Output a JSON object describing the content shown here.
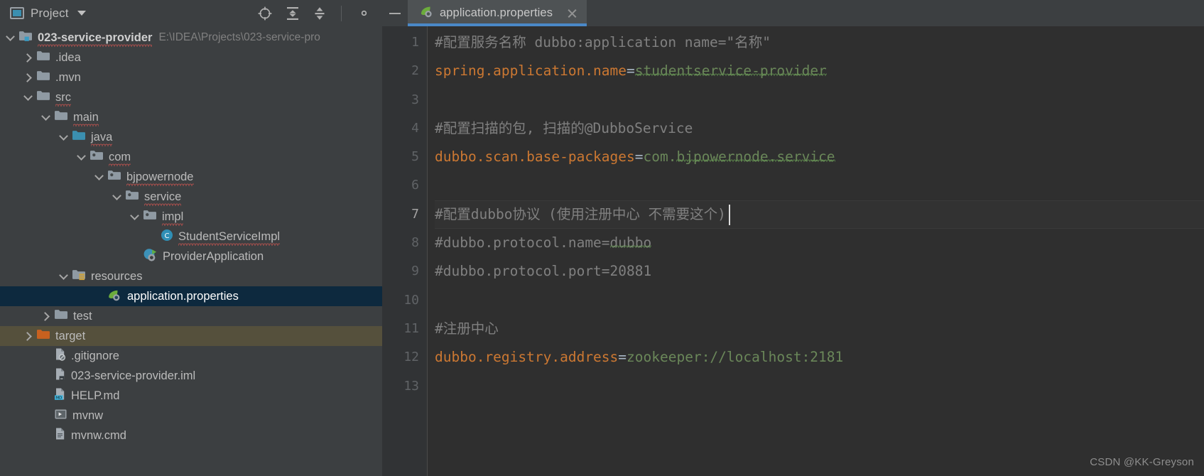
{
  "sidebar": {
    "title": "Project",
    "dropdown_icon": "chevron-down-icon",
    "tools": [
      {
        "name": "locate-icon",
        "label": "Select Opened File"
      },
      {
        "name": "expand-all-icon",
        "label": "Expand All"
      },
      {
        "name": "collapse-all-icon",
        "label": "Collapse All"
      },
      {
        "name": "gear-icon",
        "label": "Settings"
      }
    ],
    "tree": [
      {
        "label": "023-service-provider",
        "path_hint": "E:\\IDEA\\Projects\\023-service-pro",
        "indent": 0,
        "arrow": "down",
        "icon": "module-folder-icon",
        "bold": true,
        "spell": true
      },
      {
        "label": ".idea",
        "indent": 1,
        "arrow": "right",
        "icon": "folder-icon"
      },
      {
        "label": ".mvn",
        "indent": 1,
        "arrow": "right",
        "icon": "folder-icon"
      },
      {
        "label": "src",
        "indent": 1,
        "arrow": "down",
        "icon": "folder-icon",
        "spell": true
      },
      {
        "label": "main",
        "indent": 2,
        "arrow": "down",
        "icon": "folder-icon",
        "spell": true
      },
      {
        "label": "java",
        "indent": 3,
        "arrow": "down",
        "icon": "source-root-folder-icon",
        "spell": true
      },
      {
        "label": "com",
        "indent": 4,
        "arrow": "down",
        "icon": "package-folder-icon",
        "spell": true
      },
      {
        "label": "bjpowernode",
        "indent": 5,
        "arrow": "down",
        "icon": "package-folder-icon",
        "spell": true
      },
      {
        "label": "service",
        "indent": 6,
        "arrow": "down",
        "icon": "package-folder-icon",
        "spell": true
      },
      {
        "label": "impl",
        "indent": 7,
        "arrow": "down",
        "icon": "package-folder-icon",
        "spell": true
      },
      {
        "label": "StudentServiceImpl",
        "indent": 8,
        "arrow": "none",
        "icon": "java-class-icon",
        "spell": true
      },
      {
        "label": "ProviderApplication",
        "indent": 7,
        "arrow": "none",
        "icon": "spring-boot-run-icon"
      },
      {
        "label": "resources",
        "indent": 3,
        "arrow": "down",
        "icon": "resources-folder-icon"
      },
      {
        "label": "application.properties",
        "indent": 5,
        "arrow": "none",
        "icon": "spring-properties-icon",
        "selected": true
      },
      {
        "label": "test",
        "indent": 2,
        "arrow": "right",
        "icon": "folder-icon"
      },
      {
        "label": "target",
        "indent": 1,
        "arrow": "right",
        "icon": "target-folder-icon",
        "hovered": true
      },
      {
        "label": ".gitignore",
        "indent": 2,
        "arrow": "none",
        "icon": "gitignore-file-icon"
      },
      {
        "label": "023-service-provider.iml",
        "indent": 2,
        "arrow": "none",
        "icon": "iml-file-icon"
      },
      {
        "label": "HELP.md",
        "indent": 2,
        "arrow": "none",
        "icon": "markdown-file-icon"
      },
      {
        "label": "mvnw",
        "indent": 2,
        "arrow": "none",
        "icon": "script-file-icon"
      },
      {
        "label": "mvnw.cmd",
        "indent": 2,
        "arrow": "none",
        "icon": "cmd-file-icon"
      }
    ]
  },
  "editor": {
    "minimize_icon": "minimize-icon",
    "tab": {
      "title": "application.properties",
      "icon": "spring-properties-icon",
      "close_icon": "close-icon",
      "active": true
    },
    "line_numbers": [
      "1",
      "2",
      "3",
      "4",
      "5",
      "6",
      "7",
      "8",
      "9",
      "10",
      "11",
      "12",
      "13"
    ],
    "active_line": 7,
    "lines": [
      {
        "n": 1,
        "tokens": [
          {
            "t": "#配置服务名称 dubbo",
            "c": "cm"
          },
          {
            "t": ":application name=\"名称\"",
            "c": "cm"
          }
        ]
      },
      {
        "n": 2,
        "tokens": [
          {
            "t": "spring.application.name",
            "c": "key"
          },
          {
            "t": "=",
            "c": "eq"
          },
          {
            "t": "studentservice-provider",
            "c": "val",
            "wavy": true
          }
        ]
      },
      {
        "n": 3,
        "tokens": []
      },
      {
        "n": 4,
        "tokens": [
          {
            "t": "#配置扫描的包, 扫描的@DubboService",
            "c": "cm"
          }
        ]
      },
      {
        "n": 5,
        "tokens": [
          {
            "t": "dubbo.scan.base-packages",
            "c": "key"
          },
          {
            "t": "=",
            "c": "eq"
          },
          {
            "t": "com.",
            "c": "val"
          },
          {
            "t": "bjpowernode.service",
            "c": "val",
            "wavy": true
          }
        ]
      },
      {
        "n": 6,
        "tokens": []
      },
      {
        "n": 7,
        "tokens": [
          {
            "t": "#配置dubbo协议 (使用注册中心 不需要这个)",
            "c": "cm"
          }
        ]
      },
      {
        "n": 8,
        "tokens": [
          {
            "t": "#dubbo.protocol.name=",
            "c": "cm"
          },
          {
            "t": "dubbo",
            "c": "cm",
            "wavy": true
          }
        ]
      },
      {
        "n": 9,
        "tokens": [
          {
            "t": "#dubbo.protocol.port=20881",
            "c": "cm"
          }
        ]
      },
      {
        "n": 10,
        "tokens": []
      },
      {
        "n": 11,
        "tokens": [
          {
            "t": "#注册中心",
            "c": "cm"
          }
        ]
      },
      {
        "n": 12,
        "tokens": [
          {
            "t": "dubbo.registry.address",
            "c": "key"
          },
          {
            "t": "=",
            "c": "eq"
          },
          {
            "t": "zookeeper://localhost:2181",
            "c": "val"
          }
        ]
      },
      {
        "n": 13,
        "tokens": []
      }
    ]
  },
  "watermark": "CSDN @KK-Greyson",
  "colors": {
    "panel_bg": "#3c3f41",
    "editor_bg": "#2f2f2f",
    "gutter_bg": "#313335",
    "selection_bg": "#0d293e",
    "hover_bg": "#55503c",
    "tab_active_underline": "#4a88c7",
    "key_orange": "#cc7832",
    "value_green": "#6a8759",
    "comment_gray": "#808080",
    "source_root_blue": "#3b8fb0",
    "target_folder_orange": "#c8611f"
  }
}
